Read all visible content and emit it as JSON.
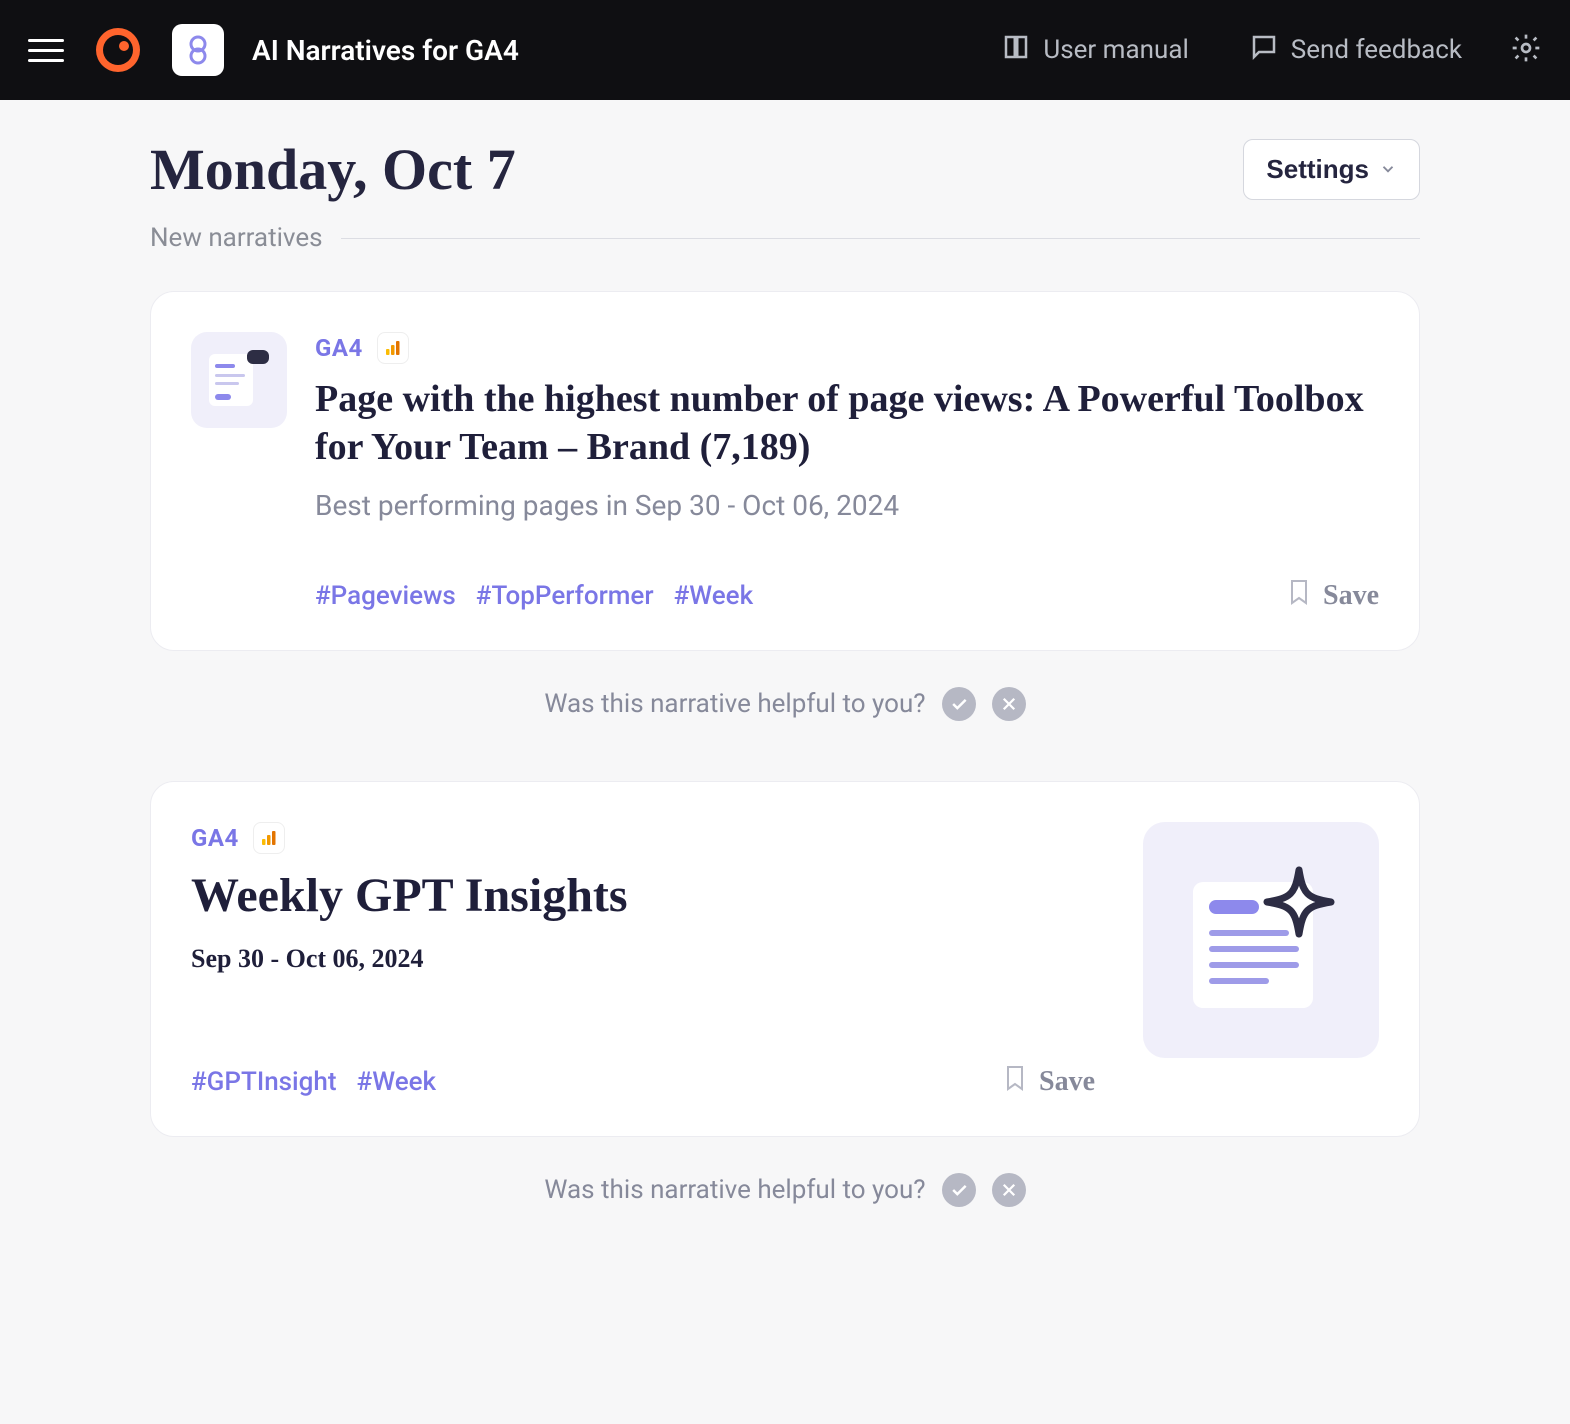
{
  "header": {
    "app_title": "AI Narratives for GA4",
    "user_manual": "User manual",
    "send_feedback": "Send feedback"
  },
  "page": {
    "title": "Monday, Oct 7",
    "settings_label": "Settings",
    "section_label": "New narratives"
  },
  "cards": [
    {
      "source": "GA4",
      "title": "Page with the highest number of page views: A Powerful Toolbox for Your Team – Brand (7,189)",
      "subtitle": "Best performing pages in Sep 30 - Oct 06, 2024",
      "tags": [
        "#Pageviews",
        "#TopPerformer",
        "#Week"
      ],
      "save_label": "Save"
    },
    {
      "source": "GA4",
      "title": "Weekly GPT Insights",
      "date": "Sep 30 - Oct 06, 2024",
      "tags": [
        "#GPTInsight",
        "#Week"
      ],
      "save_label": "Save"
    }
  ],
  "helpful": {
    "prompt": "Was this narrative helpful to you?"
  }
}
